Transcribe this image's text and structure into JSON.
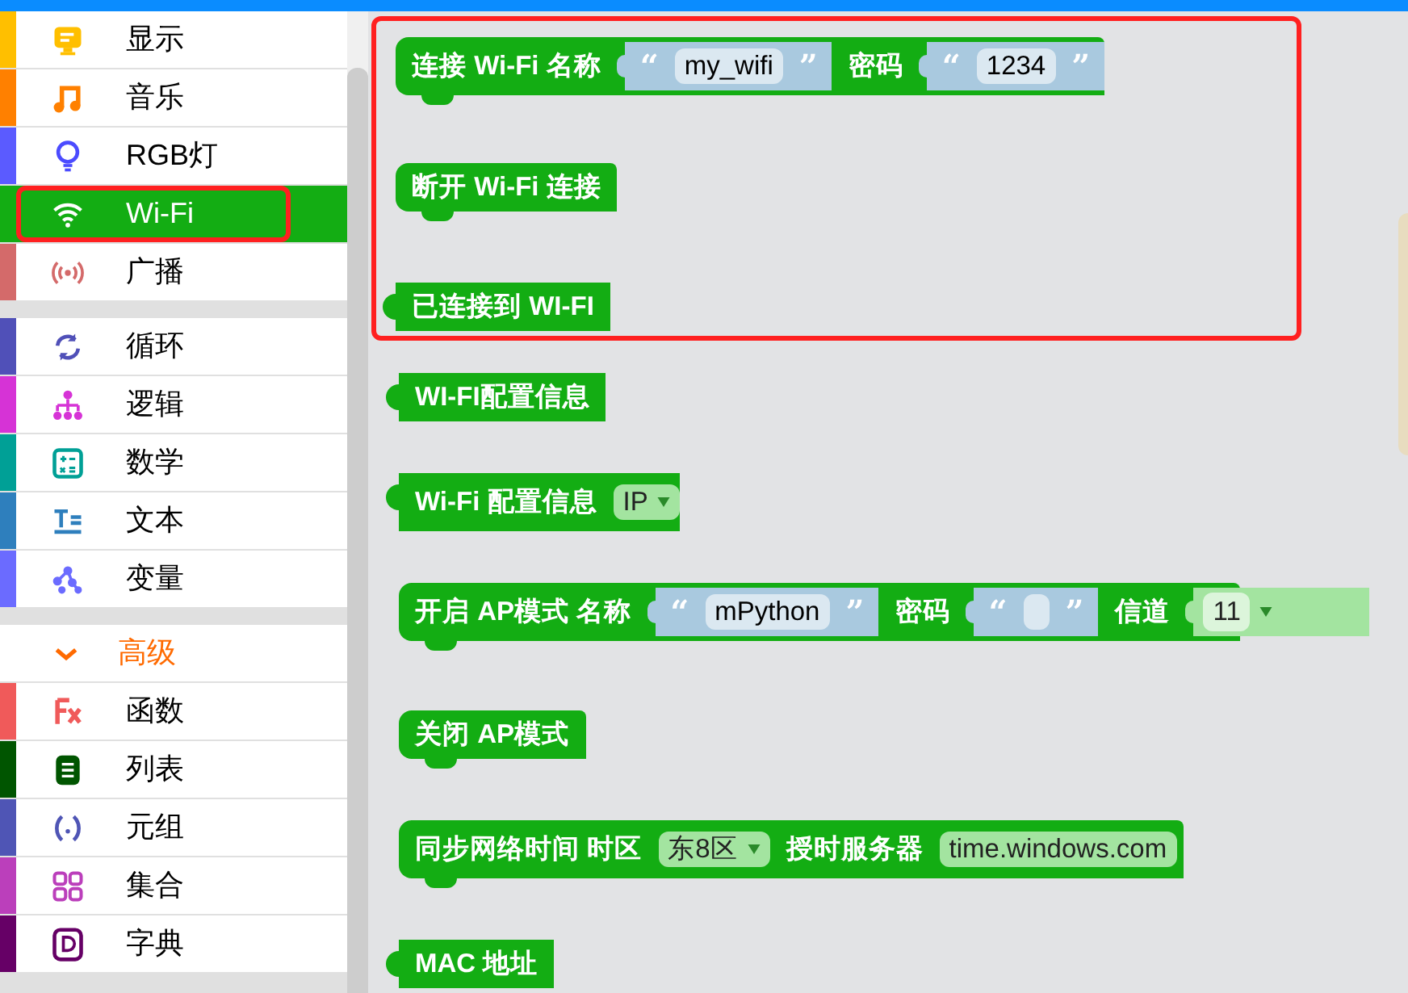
{
  "sidebar": {
    "groups": [
      {
        "items": [
          {
            "label": "显示",
            "color": "#ffbf00",
            "selected": false,
            "highlighted": false
          },
          {
            "label": "音乐",
            "color": "#ff8000",
            "selected": false,
            "highlighted": false
          },
          {
            "label": "RGB灯",
            "color": "#5b5bff",
            "selected": false,
            "highlighted": false
          },
          {
            "label": "Wi-Fi",
            "color": "#13ad13",
            "selected": true,
            "highlighted": true
          },
          {
            "label": "广播",
            "color": "#d46a6a",
            "selected": false,
            "highlighted": false
          }
        ]
      },
      {
        "items": [
          {
            "label": "循环",
            "color": "#5050b8",
            "selected": false,
            "highlighted": false
          },
          {
            "label": "逻辑",
            "color": "#d633d6",
            "selected": false,
            "highlighted": false
          },
          {
            "label": "数学",
            "color": "#00a096",
            "selected": false,
            "highlighted": false
          },
          {
            "label": "文本",
            "color": "#2e7fbd",
            "selected": false,
            "highlighted": false
          },
          {
            "label": "变量",
            "color": "#6b6bff",
            "selected": false,
            "highlighted": false
          }
        ]
      },
      {
        "items": [
          {
            "label": "高级",
            "kind": "section",
            "expanded": true
          },
          {
            "label": "函数",
            "color": "#f05a5a",
            "selected": false,
            "highlighted": false
          },
          {
            "label": "列表",
            "color": "#005500",
            "selected": false,
            "highlighted": false
          },
          {
            "label": "元组",
            "color": "#4f55b5",
            "selected": false,
            "highlighted": false
          },
          {
            "label": "集合",
            "color": "#bb3fbb",
            "selected": false,
            "highlighted": false
          },
          {
            "label": "字典",
            "color": "#660066",
            "selected": false,
            "highlighted": false
          }
        ]
      }
    ]
  },
  "workspace": {
    "highlighted_blocks": [
      {
        "kind": "statement",
        "parts": [
          {
            "kind": "text",
            "text": "连接 Wi-Fi 名称"
          },
          {
            "kind": "string",
            "open": "“",
            "value": "my_wifi",
            "close": "”"
          },
          {
            "kind": "text",
            "text": "密码"
          },
          {
            "kind": "string",
            "open": "“",
            "value": "1234",
            "close": "”"
          }
        ]
      },
      {
        "kind": "statement",
        "parts": [
          {
            "kind": "text",
            "text": "断开 Wi-Fi 连接"
          }
        ]
      },
      {
        "kind": "value",
        "parts": [
          {
            "kind": "text",
            "text": "已连接到 WI-FI"
          }
        ]
      }
    ],
    "blocks": [
      {
        "kind": "value",
        "parts": [
          {
            "kind": "text",
            "text": "WI-FI配置信息"
          }
        ]
      },
      {
        "kind": "value",
        "parts": [
          {
            "kind": "text",
            "text": "Wi-Fi 配置信息"
          },
          {
            "kind": "dropdown",
            "value": "IP"
          }
        ]
      },
      {
        "kind": "statement",
        "parts": [
          {
            "kind": "text",
            "text": "开启 AP模式 名称"
          },
          {
            "kind": "string",
            "open": "“",
            "value": "mPython",
            "close": "”"
          },
          {
            "kind": "text",
            "text": "密码"
          },
          {
            "kind": "string",
            "open": "“",
            "close": "”"
          },
          {
            "kind": "text",
            "text": "信道"
          },
          {
            "kind": "socket_dropdown",
            "value": "11"
          }
        ]
      },
      {
        "kind": "statement",
        "parts": [
          {
            "kind": "text",
            "text": "关闭 AP模式"
          }
        ]
      },
      {
        "kind": "statement",
        "parts": [
          {
            "kind": "text",
            "text": "同步网络时间 时区"
          },
          {
            "kind": "dropdown",
            "value": "东8区"
          },
          {
            "kind": "text",
            "text": "授时服务器"
          },
          {
            "kind": "field",
            "value": "time.windows.com"
          }
        ]
      },
      {
        "kind": "value",
        "parts": [
          {
            "kind": "text",
            "text": "MAC 地址"
          }
        ]
      }
    ]
  }
}
